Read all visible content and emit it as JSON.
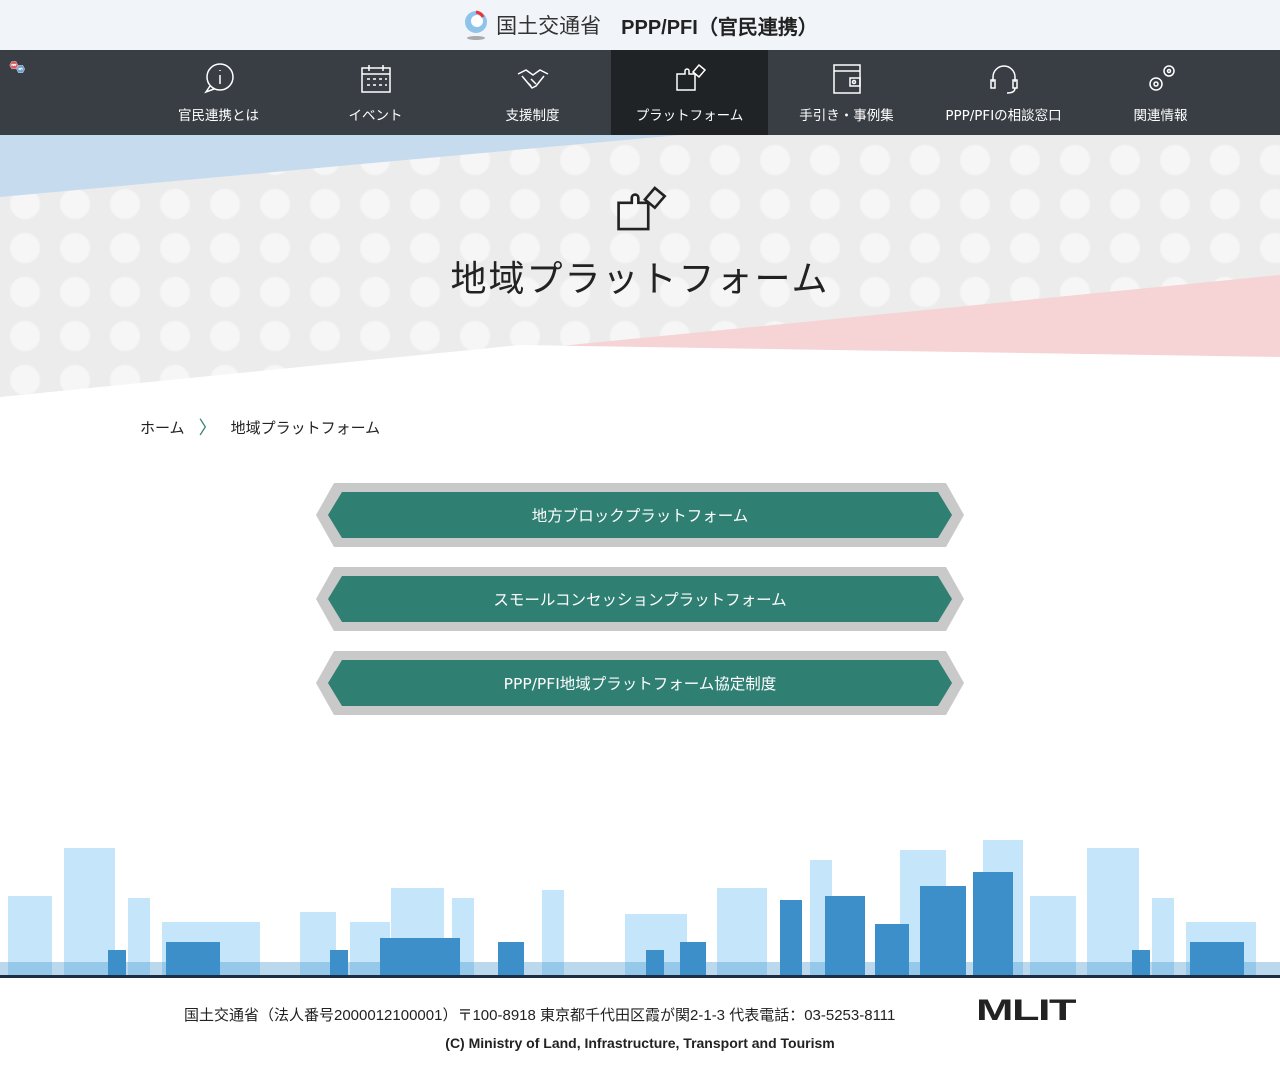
{
  "header": {
    "ministry": "国土交通省",
    "site_title": "PPP/PFI（官民連携）"
  },
  "nav": {
    "logo_ppp": "PPP",
    "logo_pfi": "PFI",
    "items": [
      {
        "label": "官民連携とは",
        "icon": "info-bubble-icon"
      },
      {
        "label": "イベント",
        "icon": "calendar-icon"
      },
      {
        "label": "支援制度",
        "icon": "handshake-icon"
      },
      {
        "label": "プラットフォーム",
        "icon": "puzzle-icon",
        "active": true
      },
      {
        "label": "手引き・事例集",
        "icon": "wallet-icon"
      },
      {
        "label": "PPP/PFIの相談窓口",
        "icon": "headset-icon"
      },
      {
        "label": "関連情報",
        "icon": "gears-icon"
      }
    ]
  },
  "hero": {
    "title": "地域プラットフォーム"
  },
  "breadcrumb": {
    "home": "ホーム",
    "current": "地域プラットフォーム"
  },
  "buttons": [
    "地方ブロックプラットフォーム",
    "スモールコンセッションプラットフォーム",
    "PPP/PFI地域プラットフォーム協定制度"
  ],
  "footer": {
    "address": "国土交通省（法人番号2000012100001）〒100-8918 東京都千代田区霞が関2-1-3 代表電話：03-5253-8111",
    "logo": "MLIT",
    "copyright": "(C) Ministry of Land, Infrastructure, Transport and Tourism"
  },
  "colors": {
    "nav": "#393e45",
    "active": "#202326",
    "button": "#2f7f73"
  }
}
